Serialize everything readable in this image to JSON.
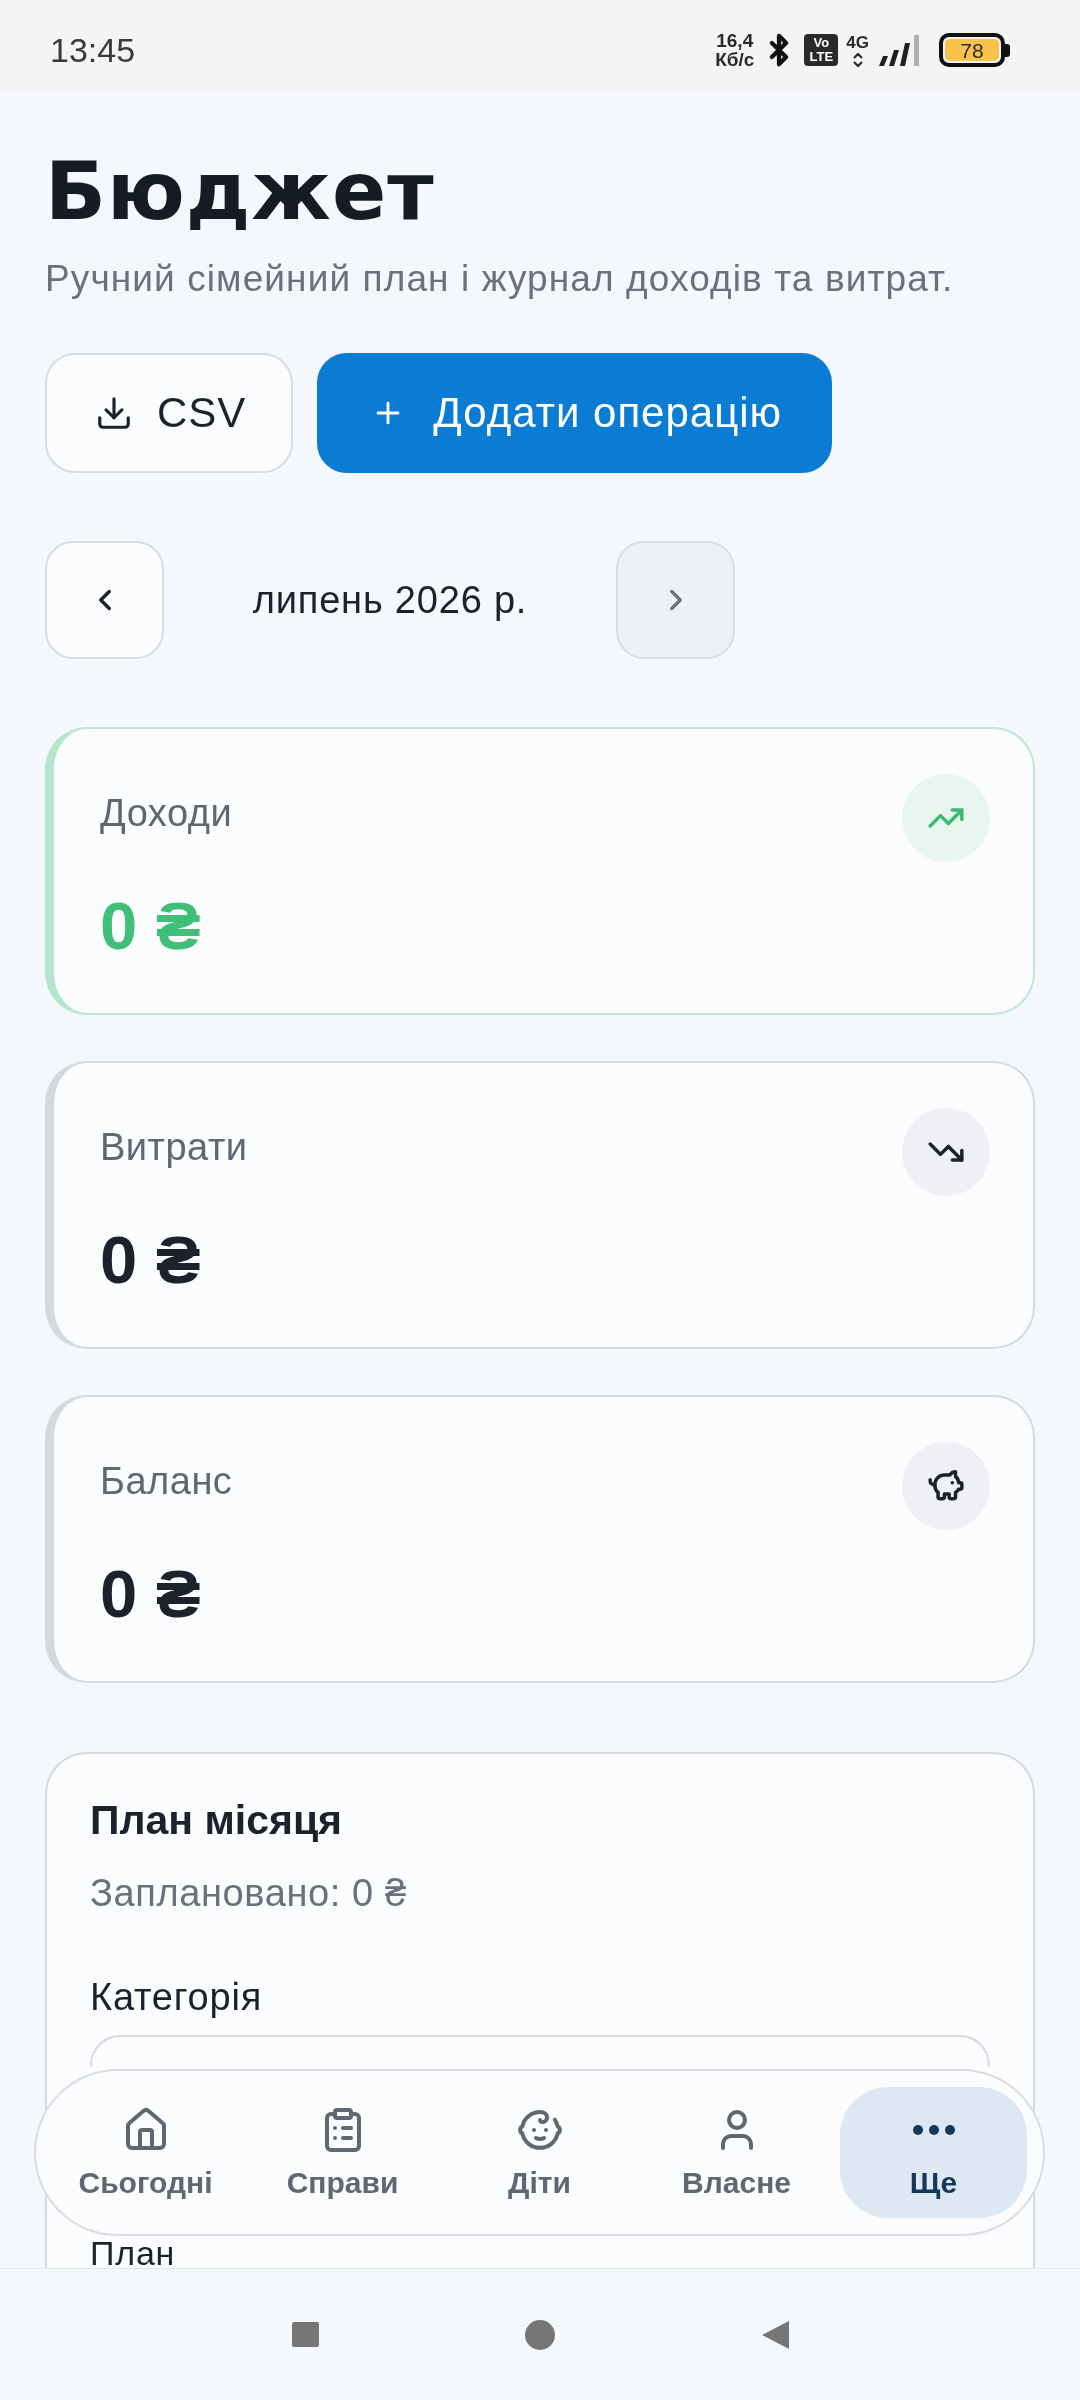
{
  "status_bar": {
    "time": "13:45",
    "network_speed": [
      "16,4",
      "Кб/с"
    ],
    "volte": [
      "Vo",
      "LTE"
    ],
    "network_type": "4G",
    "battery": "78"
  },
  "header": {
    "title": "Бюджет",
    "subtitle": "Ручний сімейний план і журнал доходів та витрат."
  },
  "actions": [
    {
      "kind": "export",
      "label": "CSV"
    },
    {
      "kind": "add",
      "label": "Додати операцію"
    }
  ],
  "month_nav": {
    "prev_button": {
      "disabled": false
    },
    "label": "липень 2026 р.",
    "next_button": {
      "disabled": true
    }
  },
  "summary_cards": [
    {
      "kind": "income",
      "label": "Доходи",
      "value": "0 ₴"
    },
    {
      "kind": "expense",
      "label": "Витрати",
      "value": "0 ₴"
    },
    {
      "kind": "balance",
      "label": "Баланс",
      "value": "0 ₴"
    }
  ],
  "plan": {
    "title": "План місяця",
    "planned": "Заплановано: 0 ₴",
    "category_label": "Категорія",
    "plan_label": "План"
  },
  "bottom_nav": [
    {
      "label": "Сьогодні",
      "selected": false
    },
    {
      "label": "Справи",
      "selected": false
    },
    {
      "label": "Діти",
      "selected": false
    },
    {
      "label": "Власне",
      "selected": false
    },
    {
      "label": "Ще",
      "selected": true
    }
  ]
}
